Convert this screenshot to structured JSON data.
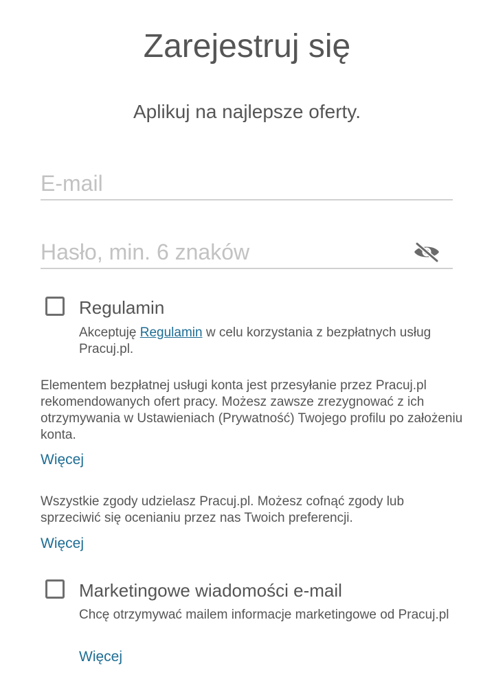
{
  "header": {
    "title": "Zarejestruj się",
    "subtitle": "Aplikuj na najlepsze oferty."
  },
  "form": {
    "email": {
      "value": "",
      "placeholder": "E-mail"
    },
    "password": {
      "value": "",
      "placeholder": "Hasło, min. 6 znaków",
      "toggle_icon": "eye-slash-icon"
    }
  },
  "terms": {
    "checked": false,
    "label": "Regulamin",
    "desc_before": "Akceptuję ",
    "desc_link": "Regulamin",
    "desc_after": " w celu korzystania z bezpłatnych usług Pracuj.pl."
  },
  "info1": {
    "text": "Elementem bezpłatnej usługi konta jest przesyłanie przez Pracuj.pl rekomendowanych ofert pracy. Możesz zawsze zrezygnować z ich otrzymywania w Ustawieniach (Prywatność) Twojego profilu po założeniu konta.",
    "more": "Więcej"
  },
  "info2": {
    "text": "Wszystkie zgody udzielasz Pracuj.pl. Możesz cofnąć zgody lub sprzeciwić się ocenianiu przez nas Twoich preferencji.",
    "more": "Więcej"
  },
  "marketing": {
    "checked": false,
    "label": "Marketingowe wiadomości e-mail",
    "desc": "Chcę otrzymywać mailem informacje marketingowe od Pracuj.pl",
    "more": "Więcej"
  },
  "colors": {
    "link": "#1e6d94",
    "text": "#555555",
    "placeholder": "#c2c2c2",
    "underline": "#d0d0d0"
  }
}
